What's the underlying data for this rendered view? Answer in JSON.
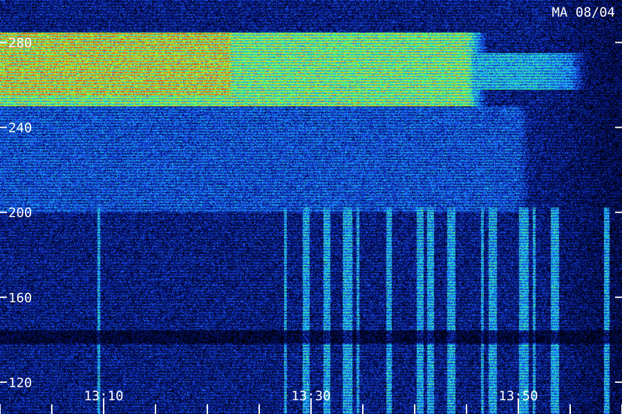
{
  "chart_data": {
    "type": "heatmap",
    "station_label": "MA 08/04",
    "y_ticks": [
      "280",
      "240",
      "200",
      "160",
      "120"
    ],
    "y_tick_values": [
      280,
      240,
      200,
      160,
      120
    ],
    "x_ticks": [
      "13:10",
      "13:30",
      "13:50"
    ],
    "x_tick_values_min": [
      10,
      30,
      50
    ],
    "ylim": [
      105,
      300
    ],
    "xlim_min": [
      0,
      60
    ],
    "x_minor_ticks_min": [
      0,
      5,
      10,
      15,
      20,
      25,
      30,
      35,
      40,
      45,
      50,
      55,
      60
    ],
    "y_minor_ticks": [
      280,
      240,
      200,
      160,
      120
    ],
    "colormap": [
      "#000000",
      "#000a4a",
      "#0a1ea8",
      "#1e5cff",
      "#1aa8ff",
      "#22e0c8",
      "#3cff7a",
      "#b4ff28",
      "#ffd400",
      "#ff3c00"
    ],
    "intensity_bands": [
      {
        "y_from": 285,
        "y_to": 250,
        "t_from": 0,
        "t_to": 45,
        "level": 0.8
      },
      {
        "y_from": 285,
        "y_to": 255,
        "t_from": 0,
        "t_to": 22,
        "level": 0.95
      },
      {
        "y_from": 275,
        "y_to": 258,
        "t_from": 40,
        "t_to": 55,
        "level": 0.55
      },
      {
        "y_from": 250,
        "y_to": 200,
        "t_from": 0,
        "t_to": 50,
        "level": 0.35
      },
      {
        "y_from": 200,
        "y_to": 105,
        "t_from": 0,
        "t_to": 60,
        "level": 0.2
      }
    ],
    "vertical_bursts_min": [
      9.5,
      27.5,
      29.5,
      31.5,
      33.5,
      34.5,
      37.5,
      40.5,
      41.5,
      43.5,
      46.5,
      47.5,
      50.5,
      51.5,
      53.5,
      58.5
    ]
  }
}
